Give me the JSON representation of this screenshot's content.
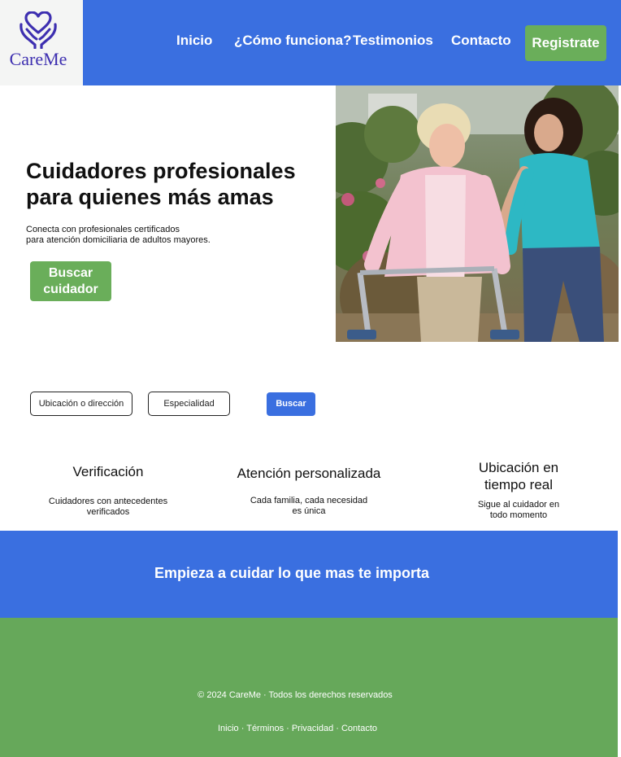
{
  "brand": {
    "name": "CareMe"
  },
  "nav": {
    "items": [
      {
        "label": "Inicio"
      },
      {
        "label": "¿Cómo funciona?"
      },
      {
        "label": "Testimonios"
      },
      {
        "label": "Contacto"
      }
    ],
    "register_label": "Registrate"
  },
  "hero": {
    "title_line1": "Cuidadores profesionales",
    "title_line2": "para quienes más amas",
    "subtitle_line1": "Conecta con profesionales certificados",
    "subtitle_line2": "para atención domiciliaria de adultos mayores.",
    "button_line1": "Buscar",
    "button_line2": "cuidador"
  },
  "search": {
    "location_placeholder": "Ubicación o dirección",
    "specialty_placeholder": "Especialidad",
    "button_label": "Buscar"
  },
  "features": [
    {
      "title_line1": "Verificación",
      "title_line2": "",
      "desc_line1": "Cuidadores con antecedentes",
      "desc_line2": "verificados"
    },
    {
      "title_line1": "Atención personalizada",
      "title_line2": "",
      "desc_line1": "Cada familia, cada necesidad",
      "desc_line2": "es única"
    },
    {
      "title_line1": "Ubicación en",
      "title_line2": "tiempo real",
      "desc_line1": "Sigue al cuidador en",
      "desc_line2": "todo momento"
    }
  ],
  "cta": {
    "text": "Empieza a cuidar lo que mas te importa"
  },
  "footer": {
    "copyright": "© 2024 CareMe · Todos los derechos reservados",
    "links": "Inicio · Términos · Privacidad · Contacto"
  },
  "colors": {
    "primary_blue": "#3a6fe0",
    "accent_green": "#6aae5a",
    "footer_green": "#66a85a",
    "logo_purple": "#3d2fb0"
  },
  "icons": [
    "heart-hands-logo-icon"
  ]
}
